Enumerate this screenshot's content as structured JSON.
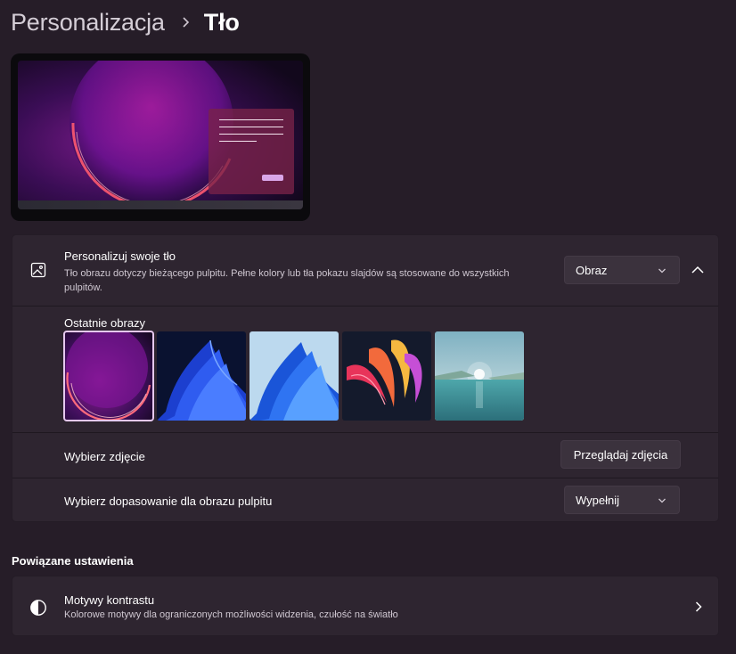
{
  "breadcrumb": {
    "parent": "Personalizacja",
    "current": "Tło"
  },
  "background_card": {
    "title": "Personalizuj swoje tło",
    "description": "Tło obrazu dotyczy bieżącego pulpitu. Pełne kolory lub tła pokazu slajdów są stosowane do wszystkich pulpitów.",
    "style_dropdown_value": "Obraz",
    "recent_images_label": "Ostatnie obrazy",
    "recent_images": [
      {
        "name": "bloom-dark",
        "selected": true
      },
      {
        "name": "bloom-blue-dark",
        "selected": false
      },
      {
        "name": "bloom-blue-light",
        "selected": false
      },
      {
        "name": "flow-colorful",
        "selected": false
      },
      {
        "name": "lake-sunrise",
        "selected": false
      }
    ],
    "choose_photo_label": "Wybierz zdjęcie",
    "browse_button_label": "Przeglądaj zdjęcia",
    "fit_label": "Wybierz dopasowanie dla obrazu pulpitu",
    "fit_dropdown_value": "Wypełnij"
  },
  "related": {
    "section_title": "Powiązane ustawienia",
    "contrast": {
      "title": "Motywy kontrastu",
      "description": "Kolorowe motywy dla ograniczonych możliwości widzenia, czułość na światło"
    }
  },
  "colors": {
    "page_background": "#261d28",
    "card_background": "#2e2530",
    "control_background": "#3b323d",
    "selection_outline": "#e5c8ef"
  },
  "icons": {
    "breadcrumb_separator": "chevron-right-icon",
    "background": "image-icon",
    "dropdown": "chevron-down-icon",
    "collapse": "chevron-up-icon",
    "contrast": "contrast-icon",
    "navigate": "chevron-right-icon"
  }
}
